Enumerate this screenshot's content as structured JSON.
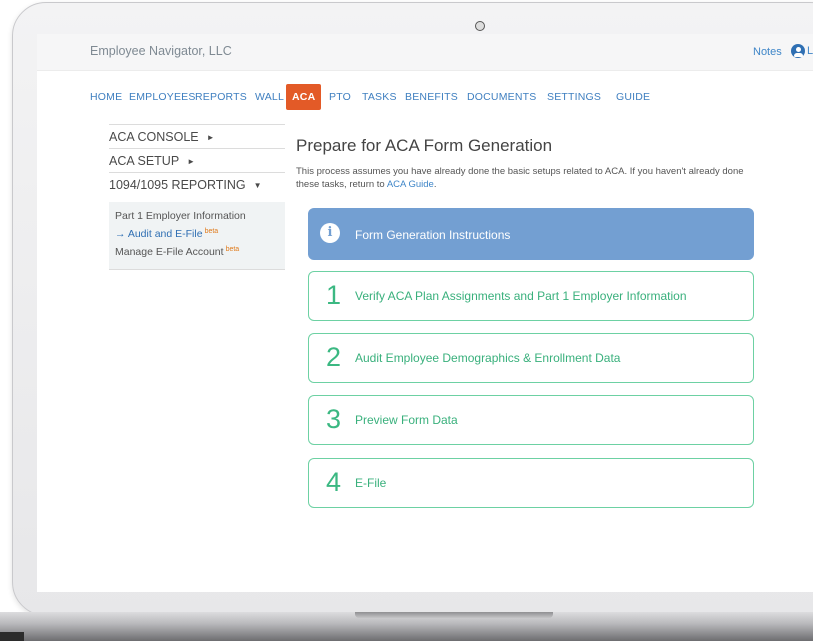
{
  "header": {
    "company": "Employee Navigator, LLC",
    "notes_label": "Notes",
    "user_initial": "L"
  },
  "nav": {
    "items": [
      "HOME",
      "EMPLOYEES",
      "REPORTS",
      "WALL",
      "ACA",
      "PTO",
      "TASKS",
      "BENEFITS",
      "DOCUMENTS",
      "SETTINGS",
      "GUIDE"
    ],
    "active": "ACA"
  },
  "sidebar": {
    "links": [
      {
        "label": "ACA CONSOLE",
        "caret": "►"
      },
      {
        "label": "ACA SETUP",
        "caret": "►"
      },
      {
        "label": "1094/1095 REPORTING",
        "caret": "▼"
      }
    ],
    "sub_items": [
      {
        "label": "Part 1 Employer Information",
        "badge": ""
      },
      {
        "label": "Audit and E-File",
        "badge": "beta",
        "prefix": "→"
      },
      {
        "label": "Manage E-File Account",
        "badge": "beta"
      }
    ]
  },
  "main": {
    "title": "Prepare for ACA Form Generation",
    "intro_text": "This process assumes you have already done the basic setups related to ACA. If you haven't already done these tasks, return to ",
    "intro_link": "ACA Guide",
    "intro_end": ".",
    "info_card": {
      "label": "Form Generation Instructions",
      "icon": "info-icon"
    },
    "steps": [
      {
        "num": "1",
        "label": "Verify ACA Plan Assignments and Part 1 Employer Information"
      },
      {
        "num": "2",
        "label": "Audit Employee Demographics & Enrollment Data"
      },
      {
        "num": "3",
        "label": "Preview Form Data"
      },
      {
        "num": "4",
        "label": "E-File"
      }
    ]
  },
  "colors": {
    "accent_orange": "#e35a27",
    "link_blue": "#3f7fc0",
    "step_green": "#3bb882",
    "info_blue": "#739fd2"
  }
}
